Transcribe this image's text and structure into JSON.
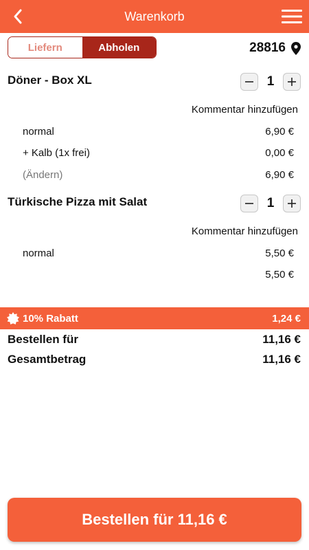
{
  "header": {
    "title": "Warenkorb"
  },
  "delivery_toggle": {
    "deliver_label": "Liefern",
    "pickup_label": "Abholen",
    "selected": "Abholen"
  },
  "location": {
    "postal_code": "28816"
  },
  "items": [
    {
      "name": "Döner - Box XL",
      "quantity": "1",
      "comment_label": "Kommentar hinzufügen",
      "lines": [
        {
          "label": "normal",
          "price": "6,90 €"
        },
        {
          "label": "+ Kalb (1x frei)",
          "price": "0,00 €"
        },
        {
          "label": "(Ändern)",
          "price": "6,90 €"
        }
      ]
    },
    {
      "name": "Türkische Pizza mit Salat",
      "quantity": "1",
      "comment_label": "Kommentar hinzufügen",
      "lines": [
        {
          "label": "normal",
          "price": "5,50 €"
        },
        {
          "label": "",
          "price": "5,50 €"
        }
      ]
    }
  ],
  "discount": {
    "label": "10% Rabatt",
    "amount": "1,24 €"
  },
  "totals": {
    "order_for_label": "Bestellen für",
    "order_for_value": "11,16 €",
    "grand_total_label": "Gesamtbetrag",
    "grand_total_value": "11,16 €"
  },
  "order_button": {
    "label": "Bestellen für 11,16 €"
  },
  "colors": {
    "accent": "#f4603a",
    "toggle_active": "#a8261a"
  }
}
